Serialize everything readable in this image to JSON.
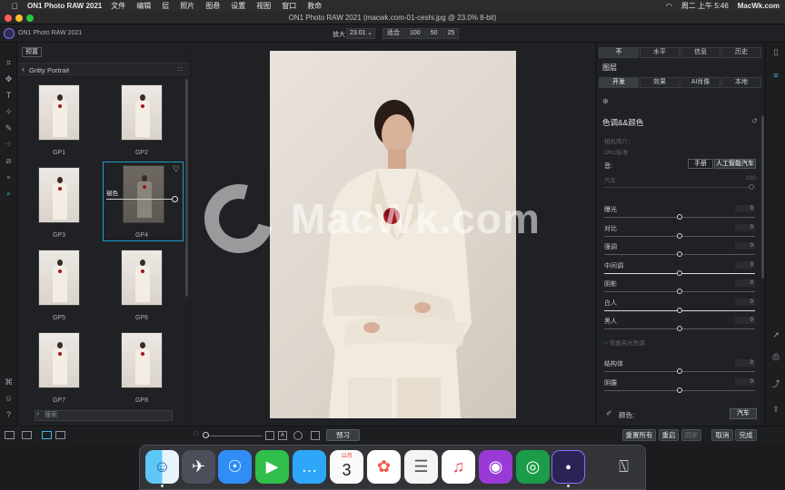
{
  "menubar": {
    "app_name": "ON1 Photo RAW 2021",
    "menus": [
      "文件",
      "编辑",
      "层",
      "照片",
      "图悬",
      "设置",
      "视图",
      "窗口",
      "救命"
    ],
    "clock": "周二 上午 5:46",
    "site": "MacWk.com"
  },
  "window": {
    "title": "ON1 Photo RAW 2021 (macwk.com-01-ceshi.jpg @ 23.0% 8-bit)"
  },
  "appbar": {
    "app_name": "ON1 Photo RAW 2021",
    "zoom_label": "放大",
    "zoom_value": "23.01",
    "fit_buttons": [
      "适合",
      "100",
      "50",
      "25"
    ]
  },
  "presets": {
    "tab_label": "预置",
    "category": "Gritty Portrait",
    "items": [
      {
        "label": "GP1"
      },
      {
        "label": "GP2"
      },
      {
        "label": "GP3"
      },
      {
        "label": "GP4"
      },
      {
        "label": "GP5"
      },
      {
        "label": "GP6"
      },
      {
        "label": "GP7"
      },
      {
        "label": "GP8"
      }
    ],
    "selected_amount_label": "褪色",
    "search_placeholder": "搜索"
  },
  "bottombar": {
    "preview": "预习",
    "actions": [
      "重置所有",
      "重启",
      "同步",
      "取消",
      "完成"
    ]
  },
  "rightpanel": {
    "tabs": [
      "不",
      "水平",
      "信息",
      "历史"
    ],
    "layers_label": "图层",
    "subtabs": [
      "开发",
      "效果",
      "AI肖像",
      "本地"
    ],
    "section_title": "色调&&颜色",
    "camera_profile_label": "相机简介：",
    "camera_profile_value": "ON1标准",
    "mode_label": "音:",
    "mode_manual": "手册",
    "mode_ai": "人工智能汽车",
    "auto_label": "汽车",
    "auto_value": "100",
    "sliders": [
      {
        "label": "曝光",
        "value": "0"
      },
      {
        "label": "对比",
        "value": "0"
      },
      {
        "label": "强调",
        "value": "0"
      },
      {
        "label": "中间调",
        "value": "0"
      },
      {
        "label": "阴影",
        "value": "0"
      },
      {
        "label": "白人",
        "value": "0"
      },
      {
        "label": "黑人",
        "value": "0"
      }
    ],
    "restore_label": "恢复高光色调",
    "sliders2": [
      {
        "label": "结构体",
        "value": "0"
      },
      {
        "label": "阴霾",
        "value": "0"
      }
    ],
    "color_label": "颜色:",
    "color_btn": "汽车"
  },
  "watermark": "MacWk.com",
  "calendar": {
    "month": "11月",
    "day": "3"
  }
}
